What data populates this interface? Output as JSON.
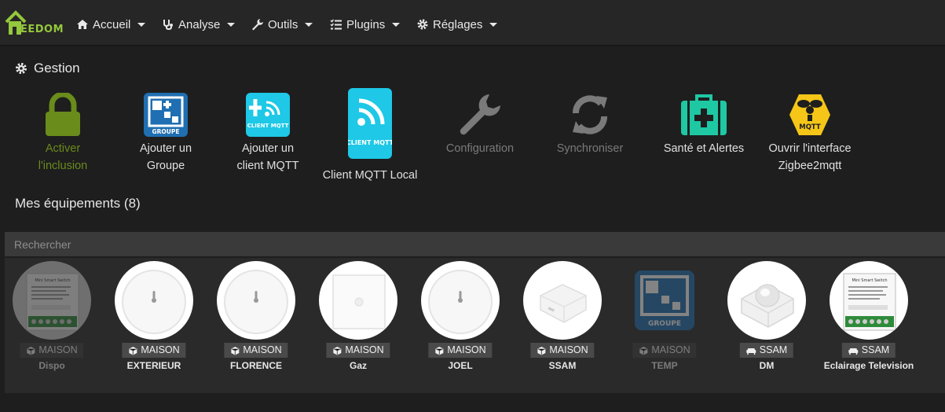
{
  "nav": {
    "logo_text": "EEDOM",
    "items": [
      {
        "label": "Accueil"
      },
      {
        "label": "Analyse"
      },
      {
        "label": "Outils"
      },
      {
        "label": "Plugins"
      },
      {
        "label": "Réglages"
      }
    ]
  },
  "gestion": {
    "title": "Gestion",
    "items": [
      {
        "line1": "Activer",
        "line2": "l'inclusion",
        "color": "#6a8c1b"
      },
      {
        "line1": "Ajouter un",
        "line2": "Groupe",
        "color": "#e0e0e0"
      },
      {
        "line1": "Ajouter un",
        "line2": "client MQTT",
        "color": "#e0e0e0"
      },
      {
        "line1": "Client MQTT Local",
        "line2": "",
        "color": "#e0e0e0"
      },
      {
        "line1": "Configuration",
        "line2": "",
        "color": "#7a7a7a"
      },
      {
        "line1": "Synchroniser",
        "line2": "",
        "color": "#7a7a7a"
      },
      {
        "line1": "Santé et Alertes",
        "line2": "",
        "color": "#e0e0e0"
      },
      {
        "line1": "Ouvrir l'interface",
        "line2": "Zigbee2mqtt",
        "color": "#e0e0e0"
      }
    ],
    "icon_labels": {
      "groupe": "GROUPE",
      "client_mqtt": "CLIENT MQTT",
      "mqtt": "MQTT"
    }
  },
  "equipements": {
    "title": "Mes équipements (8)",
    "search_placeholder": "Rechercher",
    "items": [
      {
        "object": "MAISON",
        "name": "Dispo",
        "enabled": false,
        "image": "mini-switch-icon"
      },
      {
        "object": "MAISON",
        "name": "EXTERIEUR",
        "enabled": true,
        "image": "temp-sensor-icon"
      },
      {
        "object": "MAISON",
        "name": "FLORENCE",
        "enabled": true,
        "image": "temp-sensor-icon"
      },
      {
        "object": "MAISON",
        "name": "Gaz",
        "enabled": true,
        "image": "square-sensor-icon"
      },
      {
        "object": "MAISON",
        "name": "JOEL",
        "enabled": true,
        "image": "temp-sensor-icon"
      },
      {
        "object": "MAISON",
        "name": "SSAM",
        "enabled": true,
        "image": "hub-icon"
      },
      {
        "object": "MAISON",
        "name": "TEMP",
        "enabled": false,
        "image": "groupe-icon"
      },
      {
        "object": "SSAM",
        "name": "DM",
        "enabled": true,
        "image": "motion-sensor-icon"
      },
      {
        "object": "SSAM",
        "name": "Eclairage Television",
        "enabled": true,
        "image": "mini-switch-icon"
      }
    ],
    "switch_label": "Mini Smart Switch"
  },
  "colors": {
    "accent_green": "#94c83d",
    "jeedom_blue": "#1f6fb2",
    "mqtt_cyan": "#1ec8e6",
    "health_teal": "#1ec8a3",
    "z2m_yellow": "#f5c518"
  }
}
